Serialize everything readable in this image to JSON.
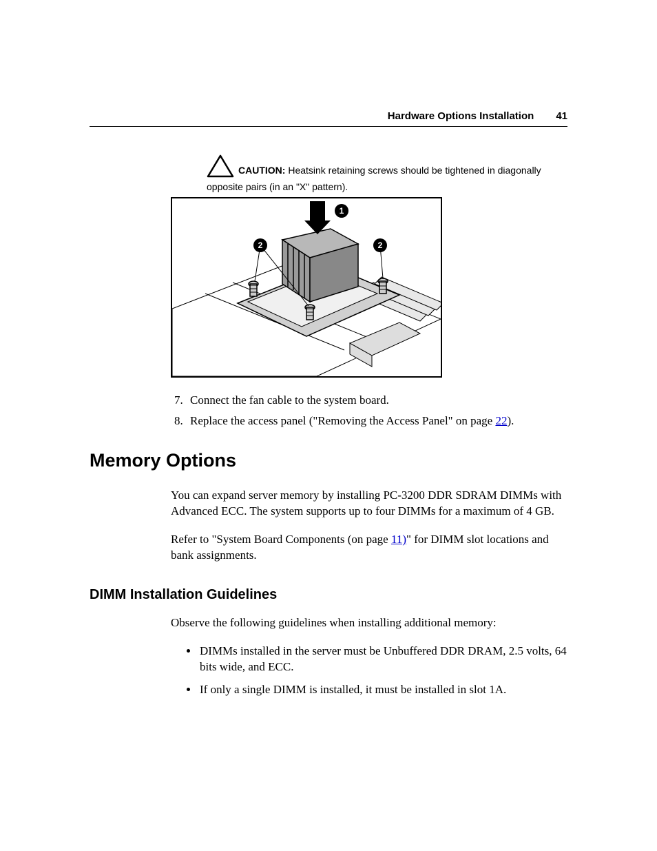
{
  "header": {
    "section_title": "Hardware Options Installation",
    "page_number": "41"
  },
  "caution": {
    "label": "CAUTION:",
    "text_after_label": "  Heatsink retaining screws should be tightened in diagonally opposite pairs (in an \"X\" pattern)."
  },
  "figure": {
    "callout1": "1",
    "callout2a": "2",
    "callout2b": "2"
  },
  "steps": {
    "start": "7",
    "item7": "Connect the fan cable to the system board.",
    "item8_prefix": "Replace the access panel (\"Removing the Access Panel\" on page ",
    "item8_link": "22",
    "item8_suffix": ")."
  },
  "memory": {
    "heading": "Memory Options",
    "para1": "You can expand server memory by installing PC-3200 DDR SDRAM DIMMs with Advanced ECC. The system supports up to four DIMMs for a maximum of 4 GB.",
    "para2_prefix": "Refer to \"System Board Components (on page ",
    "para2_link": "11)",
    "para2_suffix": "\" for DIMM slot locations and bank assignments."
  },
  "dimm": {
    "heading": "DIMM Installation Guidelines",
    "intro": "Observe the following guidelines when installing additional memory:",
    "bullet1": "DIMMs installed in the server must be Unbuffered DDR DRAM, 2.5 volts, 64 bits wide, and ECC.",
    "bullet2": "If only a single DIMM is installed, it must be installed in slot 1A."
  }
}
